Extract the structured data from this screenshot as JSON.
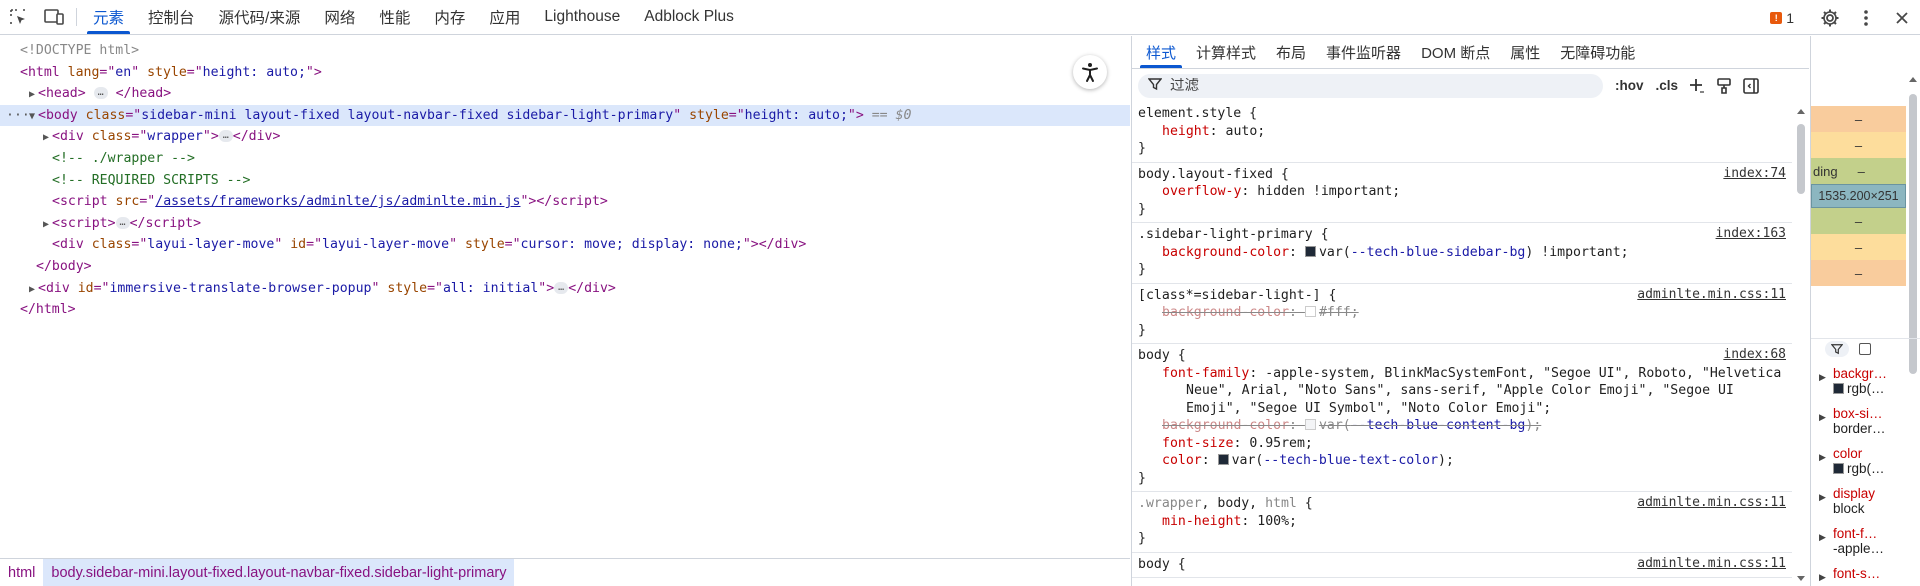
{
  "topbar": {
    "tabs": [
      "元素",
      "控制台",
      "源代码/来源",
      "网络",
      "性能",
      "内存",
      "应用",
      "Lighthouse",
      "Adblock Plus"
    ],
    "issues_count": "1"
  },
  "dom": {
    "doctype": "<!DOCTYPE html>",
    "html_lang": "en",
    "html_style": "height: auto;",
    "head_tag": "head",
    "body_class": "sidebar-mini layout-fixed layout-navbar-fixed sidebar-light-primary",
    "body_style": "height: auto;",
    "body_suffix": "== $0",
    "wrapper_class": "wrapper",
    "comment_wrapper": "<!-- ./wrapper -->",
    "comment_scripts": "<!-- REQUIRED SCRIPTS -->",
    "script_src": "/assets/frameworks/adminlte/js/adminlte.min.js",
    "layer_class": "layui-layer-move",
    "layer_id": "layui-layer-move",
    "layer_style": "cursor: move; display: none;",
    "popup_id": "immersive-translate-browser-popup",
    "popup_style": "all: initial",
    "ellipsis": "…"
  },
  "breadcrumb": {
    "items": [
      "html",
      "body.sidebar-mini.layout-fixed.layout-navbar-fixed.sidebar-light-primary"
    ]
  },
  "styles": {
    "tabs": [
      "样式",
      "计算样式",
      "布局",
      "事件监听器",
      "DOM 断点",
      "属性",
      "无障碍功能"
    ],
    "filter_placeholder": "过滤",
    "hov": ":hov",
    "cls": ".cls",
    "rules": {
      "r1": {
        "selector": "element.style {",
        "prop": "height",
        "val": "auto;"
      },
      "r2": {
        "selector": "body.layout-fixed {",
        "source": "index:74",
        "prop": "overflow-y",
        "val": "hidden !important;"
      },
      "r3": {
        "selector": ".sidebar-light-primary {",
        "source": "index:163",
        "prop": "background-color",
        "val_pre": "var(",
        "var": "--tech-blue-sidebar-bg",
        "val_post": ") !important;"
      },
      "r4": {
        "selector": "[class*=sidebar-light-] {",
        "source": "adminlte.min.css:11",
        "prop": "background-color",
        "val": "#fff;"
      },
      "r5": {
        "selector": "body {",
        "source": "index:68",
        "ff_prop": "font-family",
        "ff_1": "-apple-system, BlinkMacSystemFont, \"Segoe UI\", Roboto, \"Helvetica",
        "ff_2": "Neue\", Arial, \"Noto Sans\", sans-serif, \"Apple Color Emoji\", \"Segoe UI",
        "ff_3": "Emoji\", \"Segoe UI Symbol\", \"Noto Color Emoji\";",
        "bg_prop": "background-color",
        "bg_pre": "var(",
        "bg_var": "--tech-blue-content-bg",
        "bg_post": ");",
        "fs_prop": "font-size",
        "fs_val": "0.95rem;",
        "c_prop": "color",
        "c_pre": "var(",
        "c_var": "--tech-blue-text-color",
        "c_post": ");"
      },
      "r6": {
        "selector_1": ".wrapper",
        "selector_2": ", body, ",
        "selector_3": "html",
        "selector_end": " {",
        "source": "adminlte.min.css:11",
        "prop": "min-height",
        "val": "100%;"
      },
      "r7": {
        "selector": "body {",
        "source": "adminlte.min.css:11"
      },
      "close": "}"
    }
  },
  "boxmodel": {
    "dash": "–",
    "padding_label": "ding",
    "content_size": "1535.200×251"
  },
  "computed": [
    {
      "name": "backgr…",
      "value": "rgb(…"
    },
    {
      "name": "box-si…",
      "value": "border…"
    },
    {
      "name": "color",
      "value": "rgb(…"
    },
    {
      "name": "display",
      "value": "block"
    },
    {
      "name": "font-f…",
      "value": "-apple…"
    },
    {
      "name": "font-s…",
      "value": ""
    }
  ],
  "colors": {
    "accent": "#0b57d0",
    "margin": "#f9cc9d",
    "border": "#fddd9c",
    "padding": "#c3d08b",
    "content": "#8cb6c0",
    "sidebar_bg_swatch": "#1f2937",
    "text_swatch": "#1f2937"
  }
}
